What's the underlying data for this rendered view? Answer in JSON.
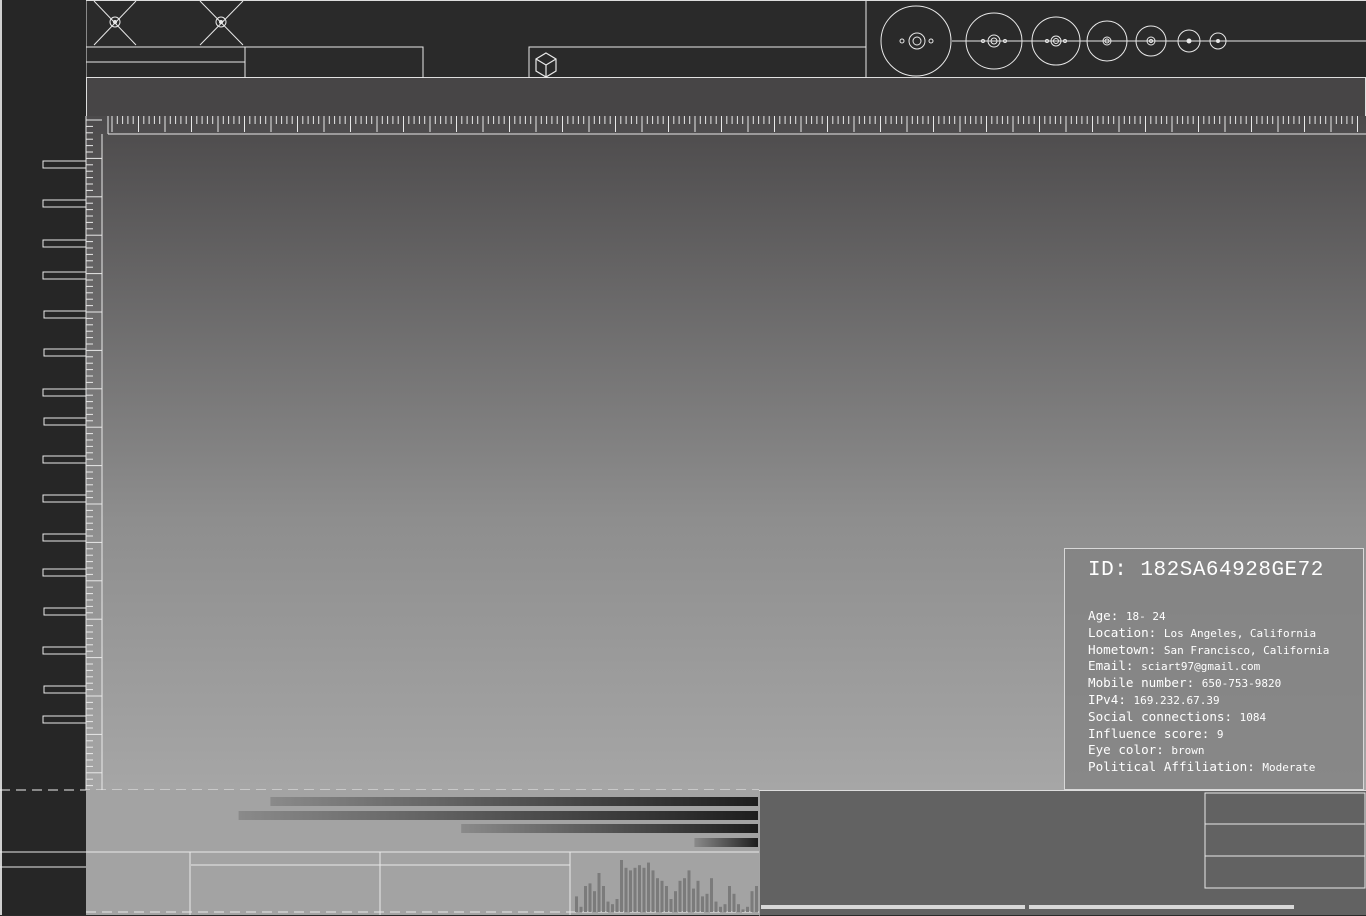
{
  "profile": {
    "id_label": "ID:",
    "id_value": "182SA64928GE72",
    "fields": [
      {
        "label": "Age:",
        "value": "18- 24"
      },
      {
        "label": "Location:",
        "value": "Los Angeles, California"
      },
      {
        "label": "Hometown:",
        "value": "San Francisco, California"
      },
      {
        "label": "Email:",
        "value": "sciart97@gmail.com"
      },
      {
        "label": "Mobile number:",
        "value": "650-753-9820"
      },
      {
        "label": "IPv4:",
        "value": "169.232.67.39"
      },
      {
        "label": "Social connections:",
        "value": "1084"
      },
      {
        "label": "Influence score:",
        "value": "9"
      },
      {
        "label": "Eye color:",
        "value": "brown"
      },
      {
        "label": "Political Affiliation:",
        "value": "Moderate"
      }
    ]
  },
  "icons": {
    "crosshair_1": "crosshair-icon",
    "crosshair_2": "crosshair-icon",
    "cube": "cube-icon",
    "orbits": "orbit-diagram-icon"
  },
  "colors": {
    "background_dark": "#2a2a2a",
    "line": "#e8e8e8",
    "gradient_top": "#4c4a4b",
    "gradient_bottom": "#a6a6a6",
    "console": "#626262"
  },
  "bottom_bars": [
    0.92,
    0.98,
    0.56,
    0.12
  ],
  "histogram": [
    6,
    2,
    10,
    11,
    8,
    15,
    10,
    4,
    3,
    5,
    20,
    17,
    16,
    17,
    18,
    17,
    19,
    16,
    13,
    12,
    10,
    5,
    8,
    12,
    13,
    16,
    9,
    12,
    6,
    7,
    13,
    4,
    2,
    3,
    10,
    7,
    3,
    1,
    2,
    8,
    10
  ]
}
